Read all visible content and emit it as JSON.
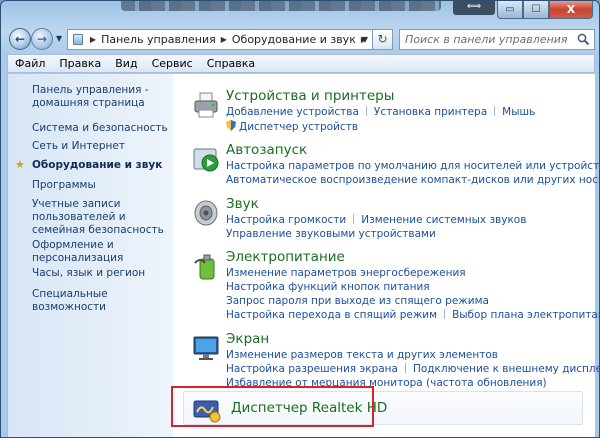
{
  "window": {
    "controls": {
      "minimize": "▭",
      "maximize": "☐",
      "close": "X"
    },
    "top_arrows": "⟺"
  },
  "address_bar": {
    "breadcrumbs": [
      "Панель управления",
      "Оборудование и звук"
    ],
    "search_placeholder": "Поиск в панели управления"
  },
  "menu": [
    "Файл",
    "Правка",
    "Вид",
    "Сервис",
    "Справка"
  ],
  "sidebar": {
    "items": [
      {
        "label": "Панель управления - домашняя страница",
        "active": false
      },
      {
        "label": "Система и безопасность",
        "active": false
      },
      {
        "label": "Сеть и Интернет",
        "active": false
      },
      {
        "label": "Оборудование и звук",
        "active": true
      },
      {
        "label": "Программы",
        "active": false
      },
      {
        "label": "Учетные записи пользователей и семейная безопасность",
        "active": false
      },
      {
        "label": "Оформление и персонализация",
        "active": false
      },
      {
        "label": "Часы, язык и регион",
        "active": false
      },
      {
        "label": "Специальные возможности",
        "active": false
      }
    ]
  },
  "categories": [
    {
      "title": "Устройства и принтеры",
      "icon": "printer-icon",
      "rows": [
        [
          "Добавление устройства",
          "Установка принтера",
          "Мышь"
        ],
        [
          "Диспетчер устройств"
        ]
      ]
    },
    {
      "title": "Автозапуск",
      "icon": "autoplay-icon",
      "rows": [
        [
          "Настройка параметров по умолчанию для носителей или устройств"
        ],
        [
          "Автоматическое воспроизведение компакт-дисков или других носителей"
        ]
      ]
    },
    {
      "title": "Звук",
      "icon": "speaker-icon",
      "rows": [
        [
          "Настройка громкости",
          "Изменение системных звуков"
        ],
        [
          "Управление звуковыми устройствами"
        ]
      ]
    },
    {
      "title": "Электропитание",
      "icon": "power-icon",
      "rows": [
        [
          "Изменение параметров энергосбережения"
        ],
        [
          "Настройка функций кнопок питания"
        ],
        [
          "Запрос пароля при выходе из спящего режима"
        ],
        [
          "Настройка перехода в спящий режим",
          "Выбор плана электропитания"
        ]
      ]
    },
    {
      "title": "Экран",
      "icon": "display-icon",
      "rows": [
        [
          "Изменение размеров текста и других элементов"
        ],
        [
          "Настройка разрешения экрана",
          "Подключение к внешнему дисплею"
        ],
        [
          "Избавление от мерцания монитора (частота обновления)"
        ]
      ]
    },
    {
      "title": "Диспетчер Realtek HD",
      "icon": "realtek-icon",
      "rows": []
    }
  ],
  "colors": {
    "category_title": "#1a6e22",
    "link": "#1a4f9c",
    "highlight": "#d8232a"
  }
}
